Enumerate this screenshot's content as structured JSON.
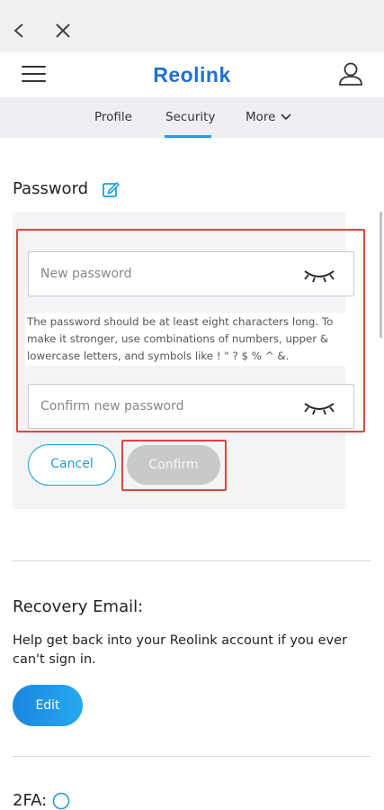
{
  "browser": {
    "back_icon": "chevron-left-icon",
    "close_icon": "close-icon"
  },
  "header": {
    "logo": "Reolink",
    "menu_icon": "hamburger-icon",
    "user_icon": "user-icon"
  },
  "tabs": [
    {
      "label": "Profile"
    },
    {
      "label": "Security",
      "active": true
    },
    {
      "label": "More"
    }
  ],
  "password": {
    "title": "Password",
    "new_placeholder": "New password",
    "hint": "The password should be at least eight characters long. To make it stronger, use combinations of numbers, upper & lowercase letters, and symbols like ! \" ? $ % ^ &.",
    "confirm_placeholder": "Confirm new password",
    "cancel_label": "Cancel",
    "confirm_label": "Confirm"
  },
  "recovery": {
    "title": "Recovery Email:",
    "description": "Help get back into your Reolink account if you ever can't sign in.",
    "edit_label": "Edit"
  },
  "twofa": {
    "title": "2FA:"
  },
  "colors": {
    "accent": "#1aa0e0",
    "brand": "#1f6fd8",
    "highlight": "#e0443e",
    "disabled": "#c9c9c9"
  }
}
